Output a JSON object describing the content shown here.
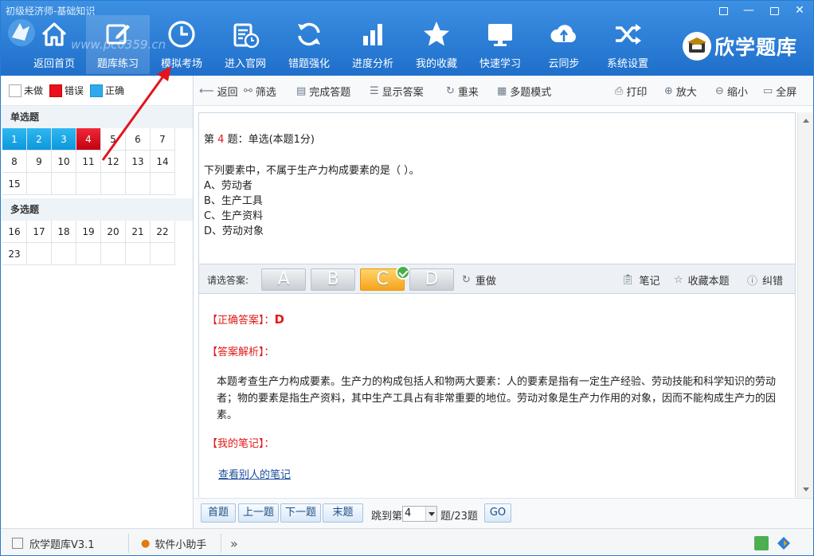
{
  "window": {
    "title": "初级经济师-基础知识",
    "controls": [
      "▣",
      "—",
      "▢",
      "✕"
    ]
  },
  "watermark": "www.pc0359.cn",
  "nav": [
    {
      "label": "返回首页",
      "icon": "home-icon"
    },
    {
      "label": "题库练习",
      "icon": "edit-icon"
    },
    {
      "label": "模拟考场",
      "icon": "clock-icon"
    },
    {
      "label": "进入官网",
      "icon": "calendar-clock-icon"
    },
    {
      "label": "错题强化",
      "icon": "refresh-icon"
    },
    {
      "label": "进度分析",
      "icon": "bar-chart-icon"
    },
    {
      "label": "我的收藏",
      "icon": "star-icon"
    },
    {
      "label": "快速学习",
      "icon": "monitor-icon"
    },
    {
      "label": "云同步",
      "icon": "cloud-sync-icon"
    },
    {
      "label": "系统设置",
      "icon": "shuffle-icon"
    }
  ],
  "brand": {
    "name": "欣学题库"
  },
  "legend": {
    "undone": "未做",
    "wrong": "错误",
    "correct": "正确"
  },
  "sections": {
    "single": {
      "title": "单选题",
      "numbers": [
        "1",
        "2",
        "3",
        "4",
        "5",
        "6",
        "7",
        "8",
        "9",
        "10",
        "11",
        "12",
        "13",
        "14",
        "15"
      ]
    },
    "multi": {
      "title": "多选题",
      "numbers": [
        "16",
        "17",
        "18",
        "19",
        "20",
        "21",
        "22",
        "23"
      ]
    }
  },
  "colors": {
    "correct": "#1ea7ea",
    "wrong": "#d9101f",
    "accent": "#2a7bd0"
  },
  "toolbar": {
    "back": "返回",
    "filter": "筛选",
    "finish": "完成答题",
    "show_answer": "显示答案",
    "restart": "重来",
    "multi_mode": "多题模式",
    "print": "打印",
    "zoom_in": "放大",
    "zoom_out": "缩小",
    "fullscreen": "全屏"
  },
  "question": {
    "prefix": "第",
    "number": "4",
    "suffix": "题：单选(本题1分)",
    "text": "下列要素中，不属于生产力构成要素的是（ ）。",
    "options": [
      "A、劳动者",
      "B、生产工具",
      "C、生产资料",
      "D、劳动对象"
    ]
  },
  "answer_bar": {
    "label": "请选答案:",
    "choices": [
      "A",
      "B",
      "C",
      "D"
    ],
    "selected": "C",
    "redo": "重做",
    "note": "笔记",
    "favorite": "收藏本题",
    "report": "纠错"
  },
  "result": {
    "correct_label": "【正确答案】：",
    "correct_value": "D",
    "analysis_label": "【答案解析】：",
    "analysis": "本题考查生产力构成要素。生产力的构成包括人和物两大要素：人的要素是指有一定生产经验、劳动技能和科学知识的劳动者；物的要素是指生产资料，其中生产工具占有非常重要的地位。劳动对象是生产力作用的对象，因而不能构成生产力的因素。",
    "notes_label": "【我的笔记】：",
    "others_link": "查看别人的笔记"
  },
  "pager": {
    "first": "首题",
    "prev": "上一题",
    "next": "下一题",
    "last": "末题",
    "jump_prefix": "跳到第",
    "current": "4",
    "jump_suffix": "题/23题",
    "go": "GO"
  },
  "status": {
    "app": "欣学题库V3.1",
    "helper": "软件小助手",
    "more": "»"
  }
}
